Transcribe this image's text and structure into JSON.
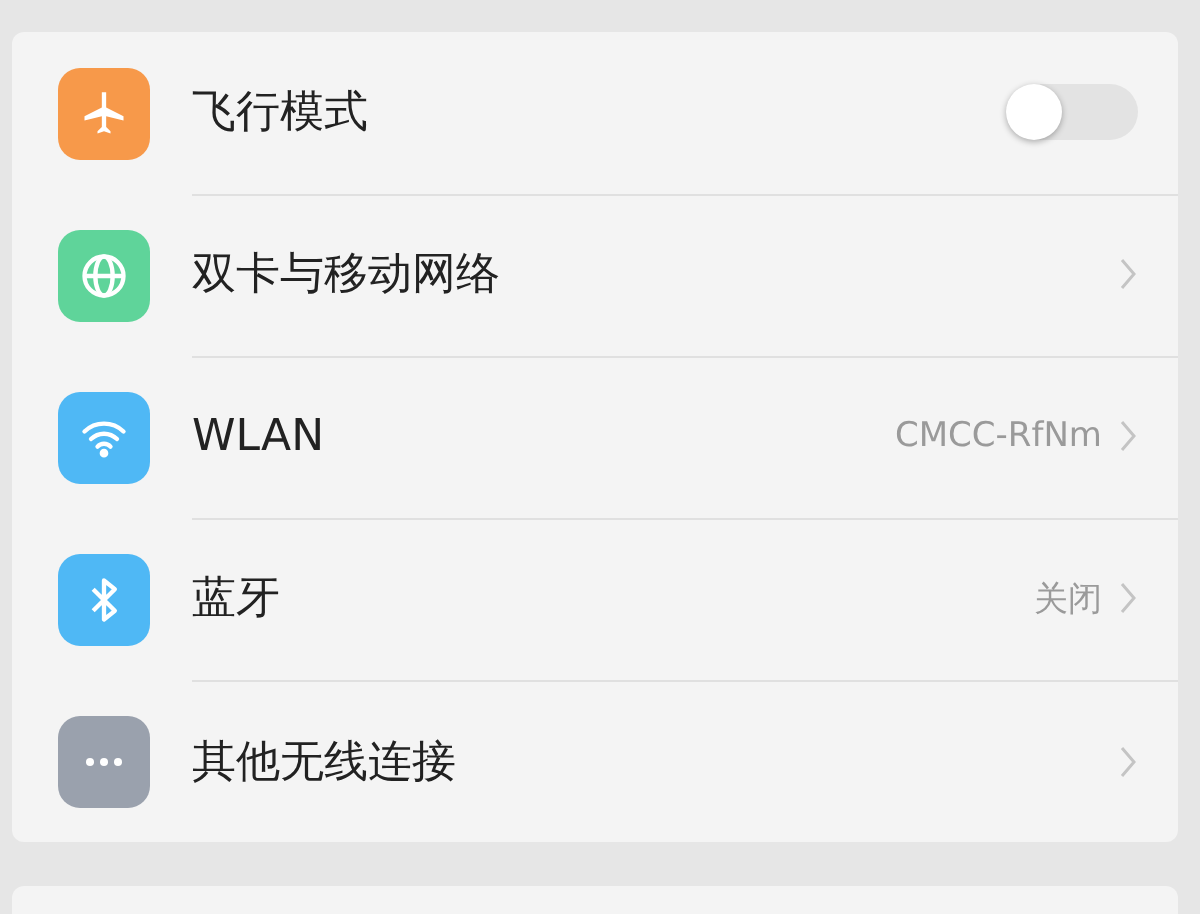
{
  "settings": [
    {
      "kind": "toggle",
      "label": "飞行模式",
      "color": "#f7994a",
      "on": false
    },
    {
      "kind": "link",
      "label": "双卡与移动网络",
      "color": "#5fd49a"
    },
    {
      "kind": "link",
      "label": "WLAN",
      "color": "#4fb8f5",
      "value": "CMCC-RfNm"
    },
    {
      "kind": "link",
      "label": "蓝牙",
      "color": "#4fb8f5",
      "value": "关闭"
    },
    {
      "kind": "link",
      "label": "其他无线连接",
      "color": "#9aa1ad"
    }
  ]
}
